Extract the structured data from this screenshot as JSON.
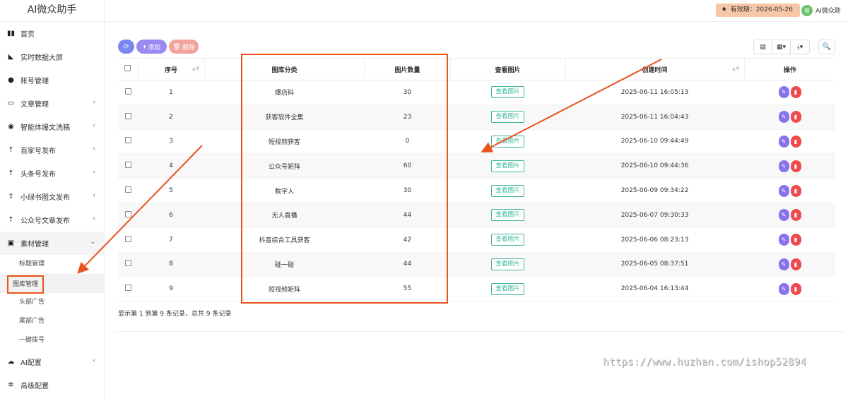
{
  "app": {
    "title": "AI微众助手"
  },
  "header": {
    "expiry_label": "有效期：",
    "expiry_date": "2026-05-26",
    "user_name": "AI微众助",
    "avatar_text": "微"
  },
  "sidebar": {
    "items": [
      {
        "label": "首页",
        "icon": "bar-chart-icon"
      },
      {
        "label": "实时数据大屏",
        "icon": "area-chart-icon"
      },
      {
        "label": "账号管理",
        "icon": "wechat-icon"
      },
      {
        "label": "文章管理",
        "icon": "folder-icon"
      },
      {
        "label": "智能体爆文洗稿",
        "icon": "robot-icon"
      },
      {
        "label": "百家号发布",
        "icon": "arrow-up-icon"
      },
      {
        "label": "头条号发布",
        "icon": "arrow-up-icon"
      },
      {
        "label": "小绿书图文发布",
        "icon": "upload-icon"
      },
      {
        "label": "公众号文章发布",
        "icon": "arrow-up-icon"
      },
      {
        "label": "素材管理",
        "icon": "image-icon"
      },
      {
        "label": "AI配置",
        "icon": "cloud-icon"
      },
      {
        "label": "高级配置",
        "icon": "gear-icon"
      }
    ],
    "sub_items": [
      "标题管理",
      "图库管理",
      "头部广告",
      "尾部广告",
      "一键拨号"
    ]
  },
  "toolbar": {
    "add_label": "添加",
    "delete_label": "删除"
  },
  "table": {
    "headers": [
      "序号",
      "图库分类",
      "图片数量",
      "查看图片",
      "创建时间",
      "操作"
    ],
    "view_label": "查看图片",
    "rows": [
      {
        "id": "1",
        "category": "爆店码",
        "count": "30",
        "created": "2025-06-11 16:05:13"
      },
      {
        "id": "2",
        "category": "获客软件全集",
        "count": "23",
        "created": "2025-06-11 16:04:43"
      },
      {
        "id": "3",
        "category": "短视频获客",
        "count": "0",
        "created": "2025-06-10 09:44:49"
      },
      {
        "id": "4",
        "category": "公众号矩阵",
        "count": "60",
        "created": "2025-06-10 09:44:36"
      },
      {
        "id": "5",
        "category": "数字人",
        "count": "30",
        "created": "2025-06-09 09:34:22"
      },
      {
        "id": "6",
        "category": "无人直播",
        "count": "44",
        "created": "2025-06-07 09:30:33"
      },
      {
        "id": "7",
        "category": "抖音综合工具获客",
        "count": "42",
        "created": "2025-06-06 08:23:13"
      },
      {
        "id": "8",
        "category": "碰一碰",
        "count": "44",
        "created": "2025-06-05 08:37:51"
      },
      {
        "id": "9",
        "category": "短视频矩阵",
        "count": "55",
        "created": "2025-06-04 16:13:44"
      }
    ]
  },
  "pagination": {
    "summary": "显示第 1 到第 9 条记录，总共 9 条记录"
  },
  "watermark": "https://www.huzhan.com/ishop52894",
  "colors": {
    "annotation": "#e8531f",
    "view_button": "#3db89b",
    "edit": "#8a72ee",
    "delete": "#ef4b4b"
  }
}
